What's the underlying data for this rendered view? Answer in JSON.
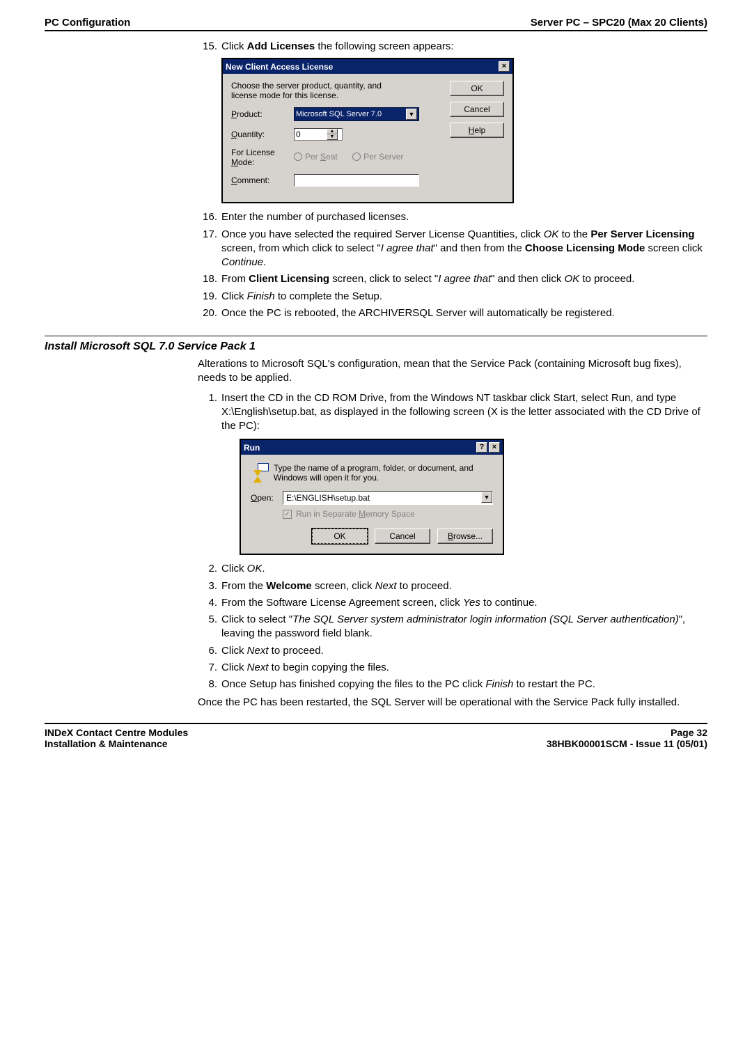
{
  "header": {
    "left": "PC Configuration",
    "right": "Server PC – SPC20 (Max 20 Clients)"
  },
  "step15": {
    "num": "15.",
    "lead": "Click ",
    "bold": "Add Licenses",
    "trail": " the following screen appears:"
  },
  "dlg1": {
    "title": "New Client Access License",
    "close": "×",
    "intro": "Choose the server product, quantity, and license mode for this license.",
    "label_product": "Product:",
    "product_value": "Microsoft SQL Server 7.0",
    "label_quantity": "Quantity:",
    "quantity_value": "0",
    "label_mode_line1": "For License",
    "label_mode_line2": "Mode:",
    "radio_seat": "Per Seat",
    "radio_server": "Per Server",
    "label_comment": "Comment:",
    "btn_ok": "OK",
    "btn_cancel": "Cancel",
    "btn_help": "Help"
  },
  "step16": {
    "num": "16.",
    "text": "Enter the number of purchased licenses."
  },
  "step17": {
    "num": "17.",
    "t1": "Once you have selected the required Server License Quantities, click ",
    "ok": "OK",
    "t2": " to the ",
    "bold1": "Per Server Licensing",
    "t3": " screen, from which click to select \"",
    "ital": "I agree that",
    "t4": "\" and then from the ",
    "bold2": "Choose Licensing Mode",
    "t5": " screen click ",
    "cont": "Continue",
    "t6": "."
  },
  "step18": {
    "num": "18.",
    "t1": "From ",
    "bold": "Client Licensing",
    "t2": " screen, click to select \"",
    "ital": "I agree that",
    "t3": "\" and then click ",
    "ok": "OK",
    "t4": " to proceed."
  },
  "step19": {
    "num": "19.",
    "t1": "Click ",
    "ital": "Finish",
    "t2": " to complete the Setup."
  },
  "step20": {
    "num": "20.",
    "text": "Once the PC is rebooted, the ARCHIVERSQL Server will automatically be registered."
  },
  "section2": {
    "title": "Install Microsoft SQL 7.0 Service Pack 1"
  },
  "s2intro": "Alterations to Microsoft SQL's configuration, mean that the Service Pack (containing Microsoft bug fixes), needs to be applied.",
  "s2step1": {
    "num": "1.",
    "text": "Insert the CD in the CD ROM Drive, from the Windows NT taskbar click Start, select Run, and type X:\\English\\setup.bat, as displayed in the following screen (X is the letter associated with the CD Drive of the PC):"
  },
  "dlg2": {
    "title": "Run",
    "help": "?",
    "close": "×",
    "desc": "Type the name of a program, folder, or document, and Windows will open it for you.",
    "label_open": "Open:",
    "open_value": "E:\\ENGLISH\\setup.bat",
    "chk_label": "Run in Separate Memory Space",
    "btn_ok": "OK",
    "btn_cancel": "Cancel",
    "btn_browse": "Browse..."
  },
  "s2step2": {
    "num": "2.",
    "t1": "Click ",
    "ital": "OK",
    "t2": "."
  },
  "s2step3": {
    "num": "3.",
    "t1": "From the ",
    "bold": "Welcome",
    "t2": " screen, click ",
    "ital": "Next",
    "t3": " to proceed."
  },
  "s2step4": {
    "num": "4.",
    "t1": "From the Software License Agreement screen, click ",
    "ital": "Yes",
    "t2": " to continue."
  },
  "s2step5": {
    "num": "5.",
    "t1": "Click to select \"",
    "ital": "The SQL Server system administrator login information (SQL Server authentication)",
    "t2": "\", leaving the password field blank."
  },
  "s2step6": {
    "num": "6.",
    "t1": "Click ",
    "ital": "Next",
    "t2": " to proceed."
  },
  "s2step7": {
    "num": "7.",
    "t1": "Click ",
    "ital": "Next",
    "t2": " to begin copying the files."
  },
  "s2step8": {
    "num": "8.",
    "t1": "Once Setup has finished copying the files to the PC click ",
    "ital": "Finish",
    "t2": " to restart the PC."
  },
  "s2outro": "Once the PC has been restarted, the SQL Server will be operational with the Service Pack fully installed.",
  "footer": {
    "l1": "INDeX Contact Centre Modules",
    "l2": "Installation & Maintenance",
    "r1": "Page 32",
    "r2": "38HBK00001SCM - Issue 11 (05/01)"
  }
}
